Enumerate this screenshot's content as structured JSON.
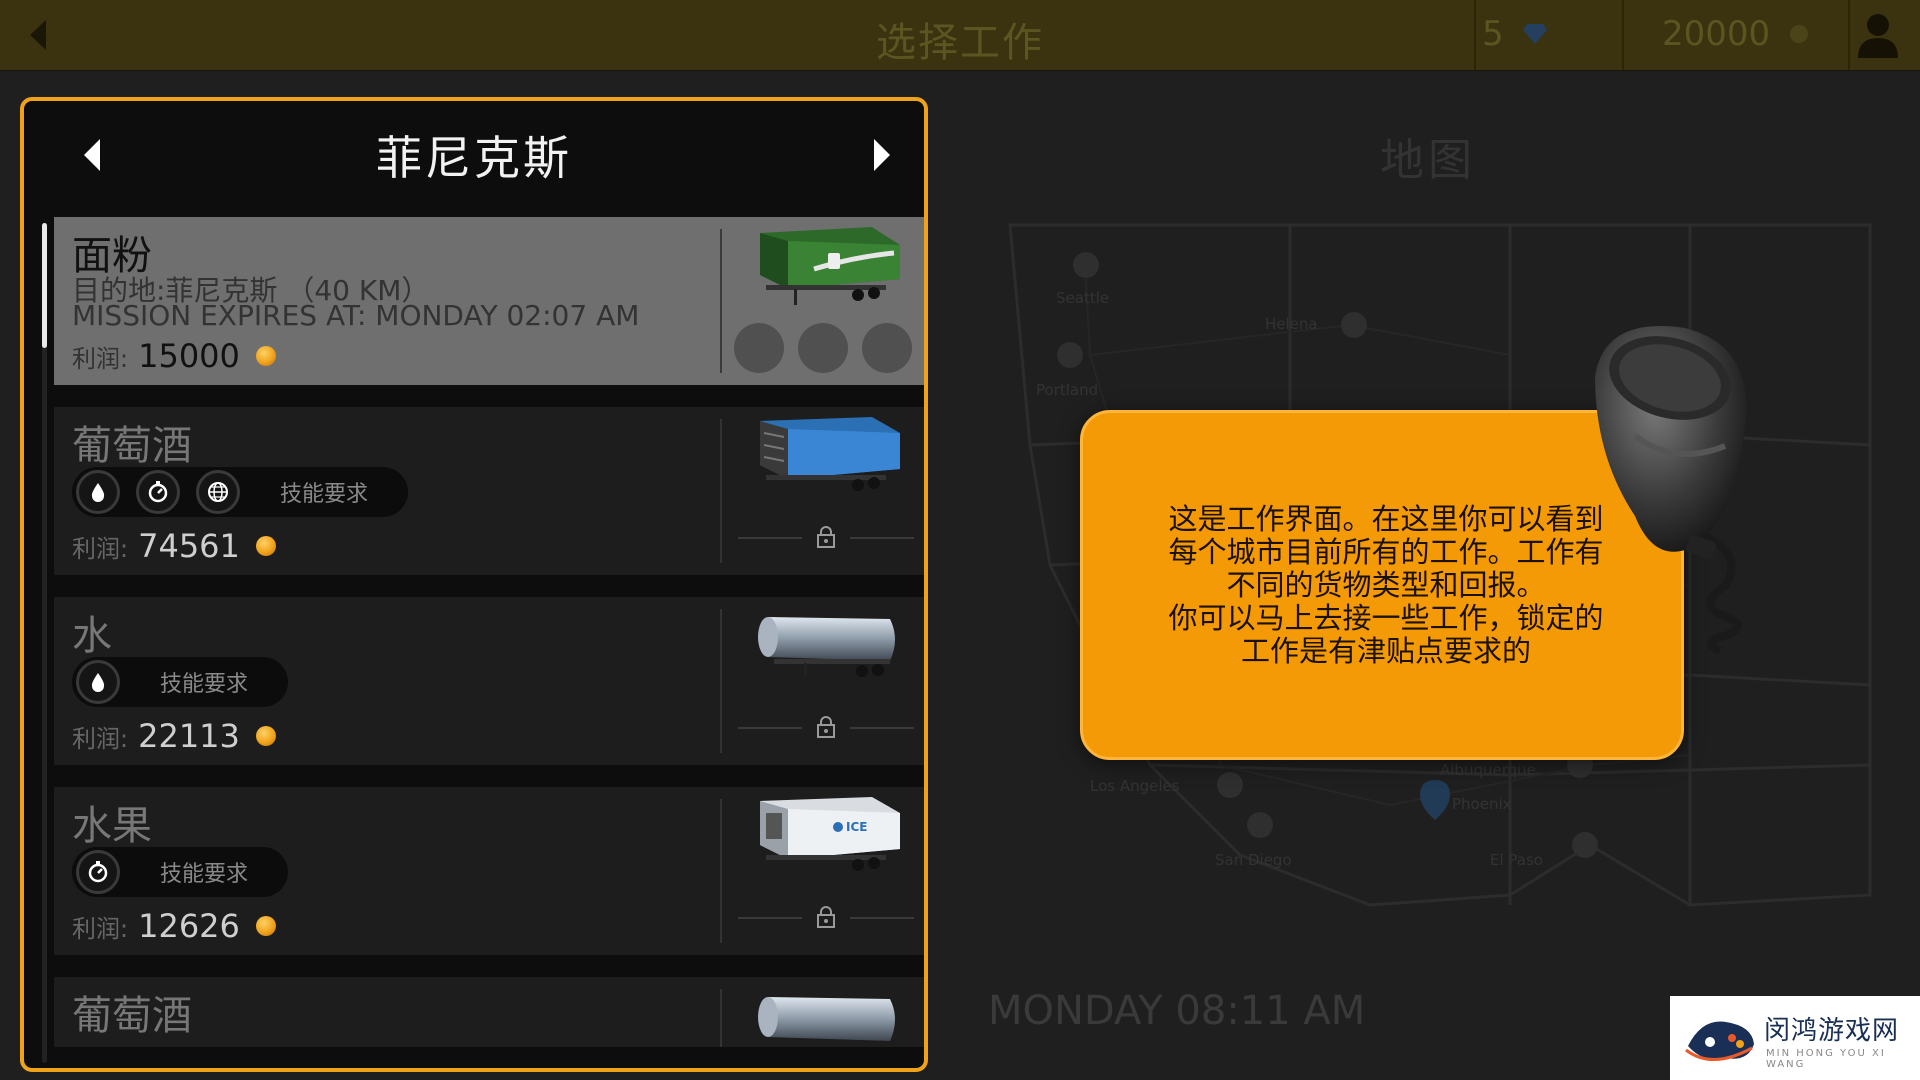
{
  "header": {
    "title": "选择工作",
    "gems": "5",
    "coins": "20000"
  },
  "panel": {
    "city": "菲尼克斯"
  },
  "jobs": [
    {
      "name": "面粉",
      "destination": "目的地:菲尼克斯 （40 KM）",
      "expires": "MISSION EXPIRES AT: MONDAY 02:07 AM",
      "profit_label": "利润:",
      "profit": "15000",
      "selected": true,
      "trailer": "green-box-trailer"
    },
    {
      "name": "葡萄酒",
      "skills": [
        "water-drop-icon",
        "stopwatch-icon",
        "globe-icon"
      ],
      "skills_label": "技能要求",
      "profit_label": "利润:",
      "profit": "74561",
      "locked": true,
      "trailer": "blue-curtain-trailer"
    },
    {
      "name": "水",
      "skills": [
        "water-drop-icon"
      ],
      "skills_label": "技能要求",
      "profit_label": "利润:",
      "profit": "22113",
      "locked": true,
      "trailer": "tanker-trailer"
    },
    {
      "name": "水果",
      "skills": [
        "stopwatch-icon"
      ],
      "skills_label": "技能要求",
      "profit_label": "利润:",
      "profit": "12626",
      "locked": true,
      "trailer": "reefer-trailer"
    },
    {
      "name": "葡萄酒",
      "trailer": "tanker-trailer"
    }
  ],
  "map": {
    "title": "地图",
    "cities": [
      "Seattle",
      "Helena",
      "Portland",
      "Los Angeles",
      "Albuquerque",
      "Phoenix",
      "San Diego",
      "El Paso"
    ],
    "time": "MONDAY 08:11 AM"
  },
  "tutorial": {
    "lines": [
      "这是工作界面。在这里你可以看到",
      "每个城市目前所有的工作。工作有",
      "不同的货物类型和回报。",
      "你可以马上去接一些工作，锁定的",
      "工作是有津贴点要求的"
    ]
  },
  "watermark": {
    "title": "闵鸿游戏网",
    "subtitle": "MIN HONG YOU XI WANG"
  },
  "colors": {
    "accent": "#f0a21a",
    "bubble": "#f59a07",
    "topbar": "#3b330f"
  }
}
